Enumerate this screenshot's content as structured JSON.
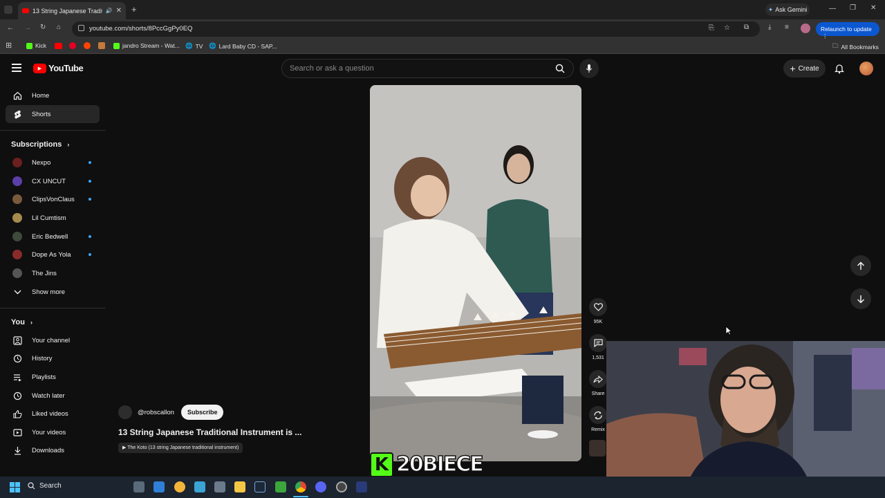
{
  "browser": {
    "tab_title": "13 String Japanese Traditio...",
    "url": "youtube.com/shorts/8PccGgPy0EQ",
    "ask_gemini": "Ask Gemini",
    "relaunch": "Relaunch to update",
    "bookmarks": [
      {
        "label": "Kick"
      },
      {
        "label": "jandro Stream - Wat..."
      },
      {
        "label": "TV"
      },
      {
        "label": "Lard Baby CD - SAP..."
      }
    ],
    "all_bookmarks": "All Bookmarks"
  },
  "header": {
    "logo_text": "YouTube",
    "search_placeholder": "Search or ask a question",
    "create_label": "Create"
  },
  "sidebar": {
    "main": [
      {
        "label": "Home"
      },
      {
        "label": "Shorts"
      }
    ],
    "subscriptions_title": "Subscriptions",
    "subscriptions": [
      {
        "label": "Nexpo",
        "color": "#6b1f1f"
      },
      {
        "label": "CX UNCUT",
        "color": "#5b3fa8"
      },
      {
        "label": "ClipsVonClaus",
        "color": "#7a5a3c"
      },
      {
        "label": "Lil Cumtism",
        "color": "#a88a4c"
      },
      {
        "label": "Eric Bedwell",
        "color": "#3e4a3a"
      },
      {
        "label": "Dope As Yola",
        "color": "#8a2b2b"
      },
      {
        "label": "The Jins",
        "color": "#555555"
      }
    ],
    "show_more": "Show more",
    "you_title": "You",
    "you_items": [
      {
        "label": "Your channel"
      },
      {
        "label": "History"
      },
      {
        "label": "Playlists"
      },
      {
        "label": "Watch later"
      },
      {
        "label": "Liked videos"
      },
      {
        "label": "Your videos"
      },
      {
        "label": "Downloads"
      }
    ]
  },
  "video": {
    "channel": "@robscallon",
    "subscribe": "Subscribe",
    "title": "13 String Japanese Traditional Instrument is ...",
    "tag": "The Koto (13 string Japanese traditional instrument)",
    "likes": "95K",
    "comments": "1,531",
    "share": "Share",
    "remix": "Remix"
  },
  "overlay": {
    "text": "20BIECE"
  },
  "taskbar": {
    "search_label": "Search"
  }
}
